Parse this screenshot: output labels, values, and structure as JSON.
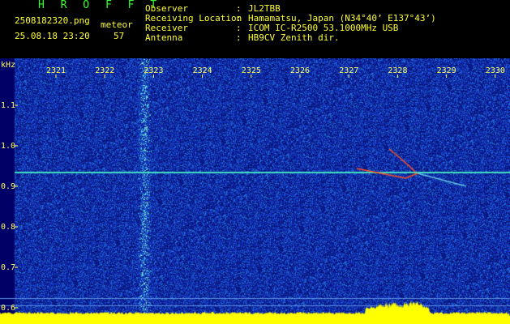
{
  "header": {
    "title": "H R O F F T",
    "filename": "2508182320.png",
    "timestamp": "25.08.18 23:20",
    "meteor_label": "meteor",
    "meteor_count": "57",
    "info": [
      {
        "key": "Observer",
        "sep": ":",
        "value": "JL2TBB"
      },
      {
        "key": "Receiving Location",
        "sep": ":",
        "value": "Hamamatsu, Japan (N34°40’ E137°43’)"
      },
      {
        "key": "Receiver",
        "sep": ":",
        "value": "ICOM IC-R2500 53.1000MHz USB"
      },
      {
        "key": "Antenna",
        "sep": ":",
        "value": "HB9CV Zenith dir."
      }
    ]
  },
  "spectrogram": {
    "y_unit": "kHz",
    "y_ticks": [
      "1.1",
      "1.0",
      "0.9",
      "0.8",
      "0.7",
      "0.6"
    ],
    "x_ticks": [
      "2321",
      "2322",
      "2323",
      "2324",
      "2325",
      "2326",
      "2327",
      "2328",
      "2329",
      "2330"
    ],
    "colors": {
      "background": "#1a2fb0",
      "noise_low": "#0a1a8a",
      "noise_high": "#3fd0e0",
      "carrier": "#40e0c0",
      "meteor": "#ff5020",
      "baseline_bar": "#ffff00",
      "tick_label": "#ffff66"
    }
  }
}
